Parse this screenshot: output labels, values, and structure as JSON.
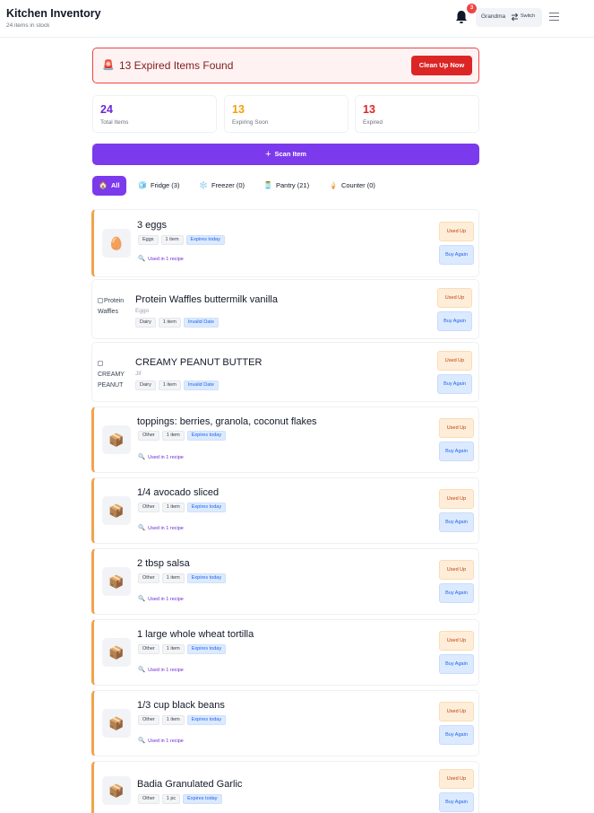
{
  "header": {
    "title": "Kitchen Inventory",
    "subtitle": "24 items in stock",
    "notification_count": "3",
    "user_name": "Grandma",
    "switch_label": "Switch"
  },
  "alert": {
    "icon": "🚨",
    "text": "13 Expired Items Found",
    "button_label": "Clean Up Now"
  },
  "stats": [
    {
      "value": "24",
      "label": "Total Items",
      "color": "#6d28d9"
    },
    {
      "value": "13",
      "label": "Expiring Soon",
      "color": "#f59e0b"
    },
    {
      "value": "13",
      "label": "Expired",
      "color": "#dc2626"
    }
  ],
  "scan_label": "Scan Item",
  "tabs": [
    {
      "icon": "🏠",
      "label": "All"
    },
    {
      "icon": "🧊",
      "label": "Fridge (3)"
    },
    {
      "icon": "❄️",
      "label": "Freezer (0)"
    },
    {
      "icon": "🫙",
      "label": "Pantry (21)"
    },
    {
      "icon": "🍦",
      "label": "Counter (0)"
    }
  ],
  "actions": {
    "used_up": "Used Up",
    "buy_again": "Buy Again"
  },
  "items": [
    {
      "name": "3 eggs",
      "icon": "🥚",
      "category": "Eggs",
      "qty": "1 item",
      "status": "Expires today",
      "recipe": "Used in 1 recipe"
    },
    {
      "name": "Protein Waffles buttermilk vanilla",
      "image_alt": "Protein Waffles",
      "brand": "Eggo",
      "category": "Dairy",
      "qty": "1 item",
      "status": "Invalid Date"
    },
    {
      "name": "CREAMY PEANUT BUTTER",
      "image_alt": "CREAMY PEANUT",
      "brand": "Jif",
      "category": "Dairy",
      "qty": "1 item",
      "status": "Invalid Date"
    },
    {
      "name": "toppings: berries, granola, coconut flakes",
      "icon": "📦",
      "category": "Other",
      "qty": "1 item",
      "status": "Expires today",
      "recipe": "Used in 1 recipe"
    },
    {
      "name": "1/4 avocado sliced",
      "icon": "📦",
      "category": "Other",
      "qty": "1 item",
      "status": "Expires today",
      "recipe": "Used in 1 recipe"
    },
    {
      "name": "2 tbsp salsa",
      "icon": "📦",
      "category": "Other",
      "qty": "1 item",
      "status": "Expires today",
      "recipe": "Used in 1 recipe"
    },
    {
      "name": "1 large whole wheat tortilla",
      "icon": "📦",
      "category": "Other",
      "qty": "1 item",
      "status": "Expires today",
      "recipe": "Used in 1 recipe"
    },
    {
      "name": "1/3 cup black beans",
      "icon": "📦",
      "category": "Other",
      "qty": "1 item",
      "status": "Expires today",
      "recipe": "Used in 1 recipe"
    },
    {
      "name": "Badia Granulated Garlic",
      "icon": "📦",
      "category": "Other",
      "qty": "1 pc",
      "status": "Expires today"
    }
  ]
}
